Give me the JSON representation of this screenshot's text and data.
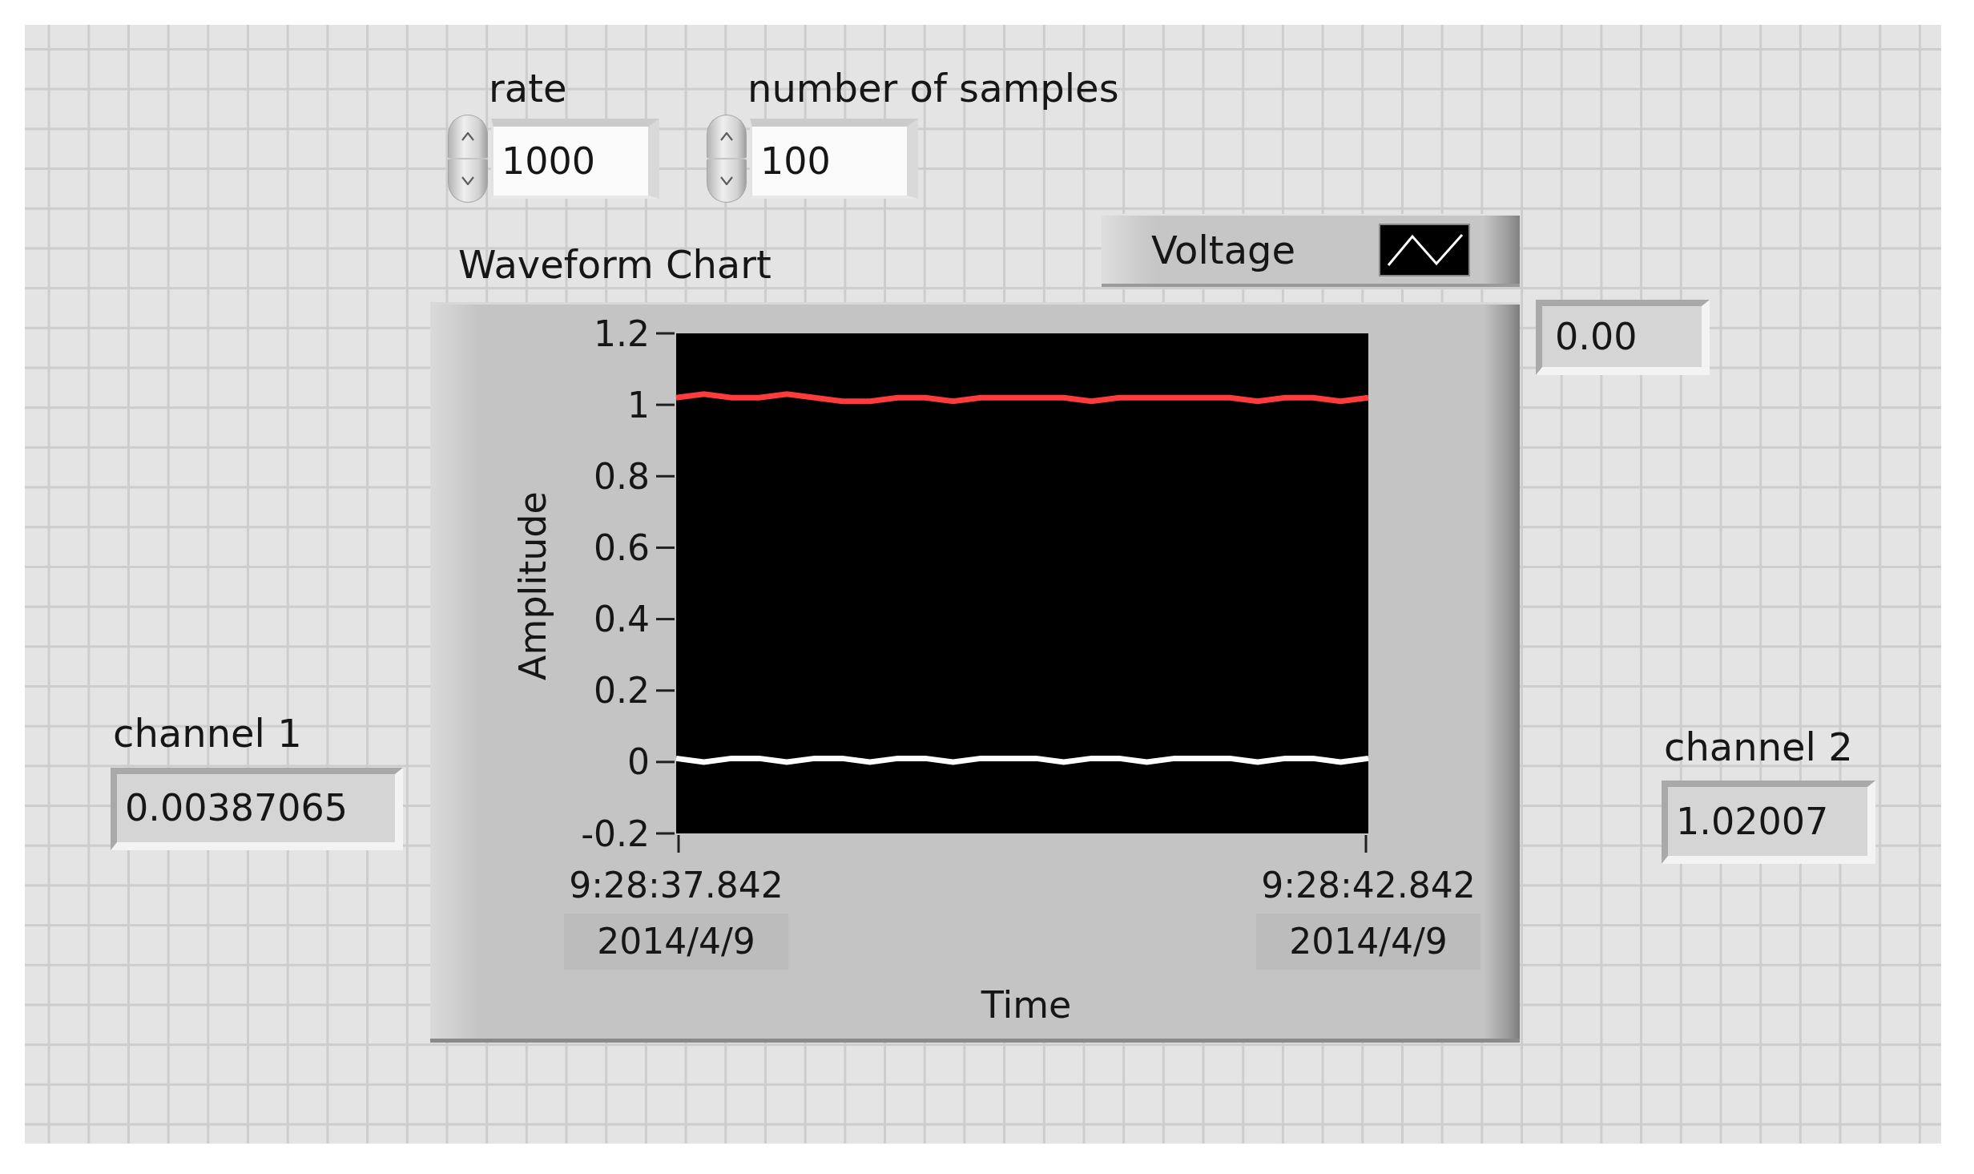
{
  "front_panel": {
    "controls": [
      {
        "label": "rate",
        "value": "1000"
      },
      {
        "label": "number of samples",
        "value": "100"
      }
    ],
    "waveform_chart": {
      "digital_display": "0.00",
      "chart_data": {
        "type": "line",
        "title": "Waveform Chart",
        "xlabel": "Time",
        "ylabel": "Amplitude",
        "categories": [
          "9:28:37.842\n2014/4/9",
          null,
          null,
          null,
          null,
          null,
          null,
          null,
          null,
          null,
          null,
          null,
          null,
          null,
          null,
          null,
          null,
          null,
          null,
          null,
          null,
          null,
          null,
          null,
          null,
          "9:28:42.842\n2014/4/9"
        ],
        "series": [
          {
            "name": "Voltage",
            "color": "#ffffff",
            "values": [
              0.01,
              0.0,
              0.01,
              0.01,
              0.0,
              0.01,
              0.01,
              0.0,
              0.01,
              0.01,
              0.0,
              0.01,
              0.01,
              0.01,
              0.0,
              0.01,
              0.01,
              0.0,
              0.01,
              0.01,
              0.01,
              0.0,
              0.01,
              0.01,
              0.0,
              0.01
            ]
          },
          {
            "color": "#ff3b3b",
            "values": [
              1.02,
              1.03,
              1.02,
              1.02,
              1.03,
              1.02,
              1.01,
              1.01,
              1.02,
              1.02,
              1.01,
              1.02,
              1.02,
              1.02,
              1.02,
              1.01,
              1.02,
              1.02,
              1.02,
              1.02,
              1.02,
              1.01,
              1.02,
              1.02,
              1.01,
              1.02
            ]
          }
        ],
        "ylim": [
          -0.2,
          1.2
        ],
        "yticks": [
          -0.2,
          0,
          0.2,
          0.4,
          0.6,
          0.8,
          1,
          1.2
        ]
      }
    },
    "indicators": [
      {
        "label": "channel 1",
        "value": "0.00387065"
      },
      {
        "label": "channel 2",
        "value": "1.02007"
      }
    ]
  }
}
